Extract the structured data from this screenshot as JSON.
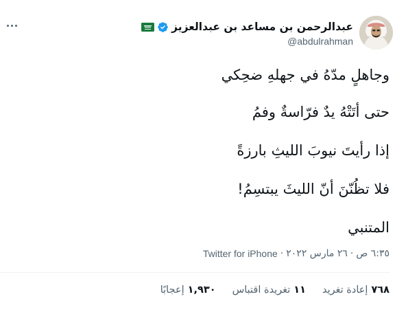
{
  "author": {
    "display_name": "عبدالرحمن بن مساعد بن عبدالعزيز",
    "handle": "@abdulrahman",
    "verified_icon": "verified-badge-icon",
    "flag_icon": "saudi-flag-icon"
  },
  "tweet": {
    "lines": [
      "وجاهلٍ مدّهُ في جهلهِ ضحِكي",
      "حتى أتَتْهُ يدٌ فرّاسةٌ وفمُ",
      "إذا رأيتَ نيوبَ الليثِ بارزةً",
      "فلا تظُنّنَ أنّ الليثَ يبتسِمُ!",
      "المتنبي"
    ]
  },
  "meta": {
    "time": "٦:٣٥ ص",
    "sep1": "·",
    "date": "٢٦ مارس ٢٠٢٢",
    "sep2": "·",
    "source": "Twitter for iPhone"
  },
  "stats": {
    "retweets": {
      "count": "٧٦٨",
      "label": "إعادة تغريد"
    },
    "quotes": {
      "count": "١١",
      "label": "تغريدة اقتباس"
    },
    "likes": {
      "count": "١,٩٣٠",
      "label": "إعجابًا"
    }
  },
  "colors": {
    "text": "#0f1419",
    "secondary": "#536471",
    "verified": "#1d9bf0",
    "divider": "#eff3f4"
  }
}
